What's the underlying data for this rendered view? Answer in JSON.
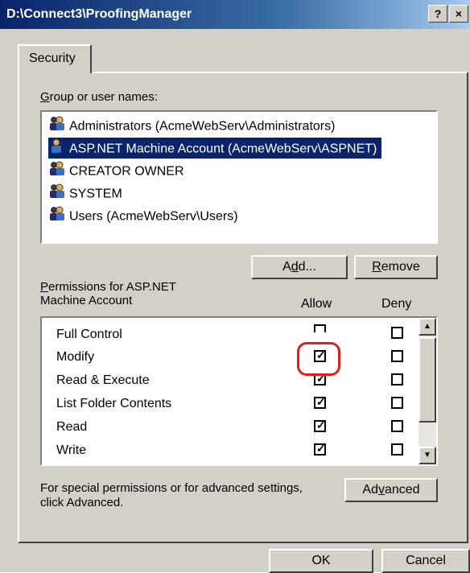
{
  "window": {
    "title": "D:\\Connect3\\ProofingManager",
    "help_glyph": "?",
    "close_glyph": "×"
  },
  "tab": {
    "label": "Security"
  },
  "groups": {
    "label_prefix": "",
    "label_accel": "G",
    "label_rest": "roup or user names:",
    "items": [
      {
        "label": "Administrators (AcmeWebServ\\Administrators)",
        "selected": false,
        "icon": "group-icon"
      },
      {
        "label": "ASP.NET Machine Account (AcmeWebServ\\ASPNET)",
        "selected": true,
        "icon": "user-icon"
      },
      {
        "label": "CREATOR OWNER",
        "selected": false,
        "icon": "group-icon"
      },
      {
        "label": "SYSTEM",
        "selected": false,
        "icon": "group-icon"
      },
      {
        "label": "Users (AcmeWebServ\\Users)",
        "selected": false,
        "icon": "group-icon"
      }
    ]
  },
  "buttons": {
    "add_pre": "A",
    "add_accel": "d",
    "add_post": "d...",
    "remove_accel": "R",
    "remove_post": "emove",
    "advanced_pre": "Ad",
    "advanced_accel": "v",
    "advanced_post": "anced",
    "ok": "OK",
    "cancel": "Cancel"
  },
  "permissions": {
    "label_accel": "P",
    "label_line1_rest": "ermissions for ASP.NET",
    "label_line2": "Machine Account",
    "allow_header": "Allow",
    "deny_header": "Deny",
    "rows": [
      {
        "name": "Full Control",
        "allow": true,
        "deny": false
      },
      {
        "name": "Modify",
        "allow": true,
        "deny": false
      },
      {
        "name": "Read & Execute",
        "allow": true,
        "deny": false
      },
      {
        "name": "List Folder Contents",
        "allow": true,
        "deny": false
      },
      {
        "name": "Read",
        "allow": true,
        "deny": false
      },
      {
        "name": "Write",
        "allow": true,
        "deny": false
      }
    ]
  },
  "advanced_note": {
    "line1": "For special permissions or for advanced settings,",
    "line2": "click Advanced."
  },
  "colors": {
    "selection": "#0a246a",
    "highlight_circle": "#e31b23",
    "dialog_face": "#d4d0c8"
  }
}
